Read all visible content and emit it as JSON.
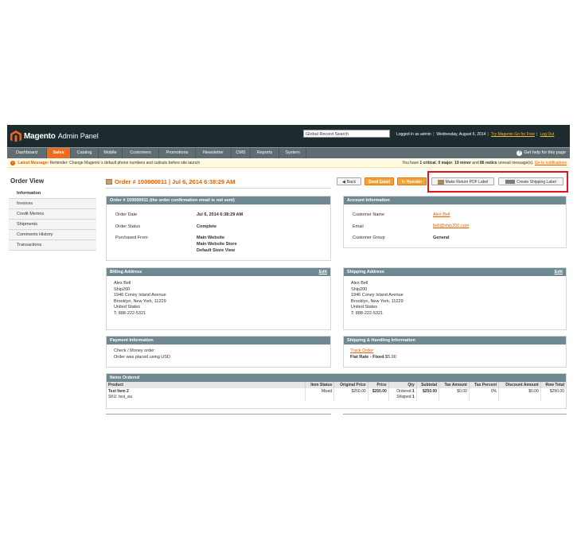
{
  "header": {
    "brand": "Magento",
    "brand_sub": "Admin Panel",
    "search_value": "Global Record Search",
    "logged_in_label": "Logged in as",
    "logged_in_user": "admin",
    "date": "Wednesday, August 6, 2014",
    "try_link": "Try Magento Go for Free",
    "logout": "Log Out"
  },
  "nav": {
    "items": [
      "Dashboard",
      "Sales",
      "Catalog",
      "Mobile",
      "Customers",
      "Promotions",
      "Newsletter",
      "CMS",
      "Reports",
      "System"
    ],
    "active": "Sales",
    "help": "Get help for this page"
  },
  "message": {
    "title": "Latest Message:",
    "text": "Reminder: Change Magento`s default phone numbers and callouts before site launch",
    "right_prefix": "You have",
    "critical": "1 critical",
    "major": "0 major",
    "minor": "19 minor",
    "notice": "86 notice",
    "right_suffix": "unread message(s).",
    "link": "Go to notifications"
  },
  "sidebar": {
    "title": "Order View",
    "items": [
      "Information",
      "Invoices",
      "Credit Memos",
      "Shipments",
      "Comments History",
      "Transactions"
    ]
  },
  "main": {
    "title": "Order # 100000011 | Jul 6, 2014 6:38:29 AM",
    "buttons": {
      "back": "Back",
      "send_email": "Send Email",
      "reorder": "Reorder",
      "return_label": "Make Return PDF Label",
      "shipping_label": "Create Shipping Label"
    }
  },
  "order_box": {
    "head": "Order # 100000011 (the order confirmation email is not sent)",
    "date_label": "Order Date",
    "date_value": "Jul 6, 2014 6:38:29 AM",
    "status_label": "Order Status",
    "status_value": "Complete",
    "purchased_label": "Purchased From",
    "purchased_1": "Main Website",
    "purchased_2": "Main Website Store",
    "purchased_3": "Default Store View"
  },
  "account_box": {
    "head": "Account Information",
    "name_label": "Customer Name",
    "name_value": "Alex Bell",
    "email_label": "Email",
    "email_value": "bell@ship200.com",
    "group_label": "Customer Group",
    "group_value": "General"
  },
  "billing_box": {
    "head": "Billing Address",
    "edit": "Edit",
    "lines": [
      "Alex Bell",
      "Ship200",
      "1946 Coney Island Avenue",
      "Brooklyn, New York, 11229",
      "United States",
      "T: 888-222-5321"
    ]
  },
  "shipping_box": {
    "head": "Shipping Address",
    "edit": "Edit",
    "lines": [
      "Alex Bell",
      "Ship200",
      "1946 Coney Island Avenue",
      "Brooklyn, New York, 11229",
      "United States",
      "T: 888-222-5321"
    ]
  },
  "payment_box": {
    "head": "Payment Information",
    "line1": "Check / Money order",
    "line2": "Order was placed using USD"
  },
  "shiphandling_box": {
    "head": "Shipping & Handling Information",
    "track": "Track Order",
    "rate_label": "Flat Rate - Fixed",
    "rate_value": "$5.00"
  },
  "items": {
    "head": "Items Ordered",
    "columns": [
      "Product",
      "Item Status",
      "Original Price",
      "Price",
      "Qty",
      "Subtotal",
      "Tax Amount",
      "Tax Percent",
      "Discount Amount",
      "Row Total"
    ],
    "row": {
      "product": "Test Item 2",
      "sku": "SKU: test_siu",
      "status": "Mixed",
      "original_price": "$250.00",
      "price": "$250.00",
      "qty_ordered_label": "Ordered",
      "qty_ordered": "1",
      "qty_shipped_label": "Shipped",
      "qty_shipped": "1",
      "subtotal": "$250.00",
      "tax_amount": "$0.00",
      "tax_percent": "0%",
      "discount": "$0.00",
      "row_total": "$250.00"
    }
  },
  "colors": {
    "header_bg": "#1d2b2e",
    "nav_bg": "#5f6d72",
    "accent": "#ec6b1c",
    "box_head": "#6f8992",
    "highlight": "#e0151b"
  }
}
